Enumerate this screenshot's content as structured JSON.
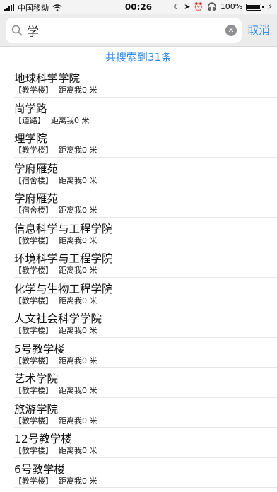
{
  "status_bar": {
    "carrier": "中国移动",
    "time": "00:26",
    "battery_percent": "100%",
    "battery_level": 1.0,
    "icons": [
      "signal-icon",
      "wifi-icon",
      "moon-icon",
      "location-icon",
      "alarm-icon",
      "headphones-icon",
      "battery-icon",
      "charging-icon"
    ]
  },
  "search": {
    "value": "学",
    "cancel_label": "取消"
  },
  "result_count": "共搜索到31条",
  "results": [
    {
      "name": "地球科学学院",
      "category": "【教学楼】",
      "distance": "距离我0 米"
    },
    {
      "name": "尚学路",
      "category": "【道路】",
      "distance": "距离我0 米"
    },
    {
      "name": "理学院",
      "category": "【教学楼】",
      "distance": "距离我0 米"
    },
    {
      "name": "学府雁苑",
      "category": "【宿舍楼】",
      "distance": "距离我0 米"
    },
    {
      "name": "学府雁苑",
      "category": "【宿舍楼】",
      "distance": "距离我0 米"
    },
    {
      "name": "信息科学与工程学院",
      "category": "【教学楼】",
      "distance": "距离我0 米"
    },
    {
      "name": "环境科学与工程学院",
      "category": "【教学楼】",
      "distance": "距离我0 米"
    },
    {
      "name": "化学与生物工程学院",
      "category": "【教学楼】",
      "distance": "距离我0 米"
    },
    {
      "name": "人文社会科学学院",
      "category": "【教学楼】",
      "distance": "距离我0 米"
    },
    {
      "name": "5号教学楼",
      "category": "【教学楼】",
      "distance": "距离我0 米"
    },
    {
      "name": "艺术学院",
      "category": "【教学楼】",
      "distance": "距离我0 米"
    },
    {
      "name": "旅游学院",
      "category": "【教学楼】",
      "distance": "距离我0 米"
    },
    {
      "name": "12号教学楼",
      "category": "【教学楼】",
      "distance": "距离我0 米"
    },
    {
      "name": "6号教学楼",
      "category": "【教学楼】",
      "distance": "距离我0 米"
    }
  ]
}
